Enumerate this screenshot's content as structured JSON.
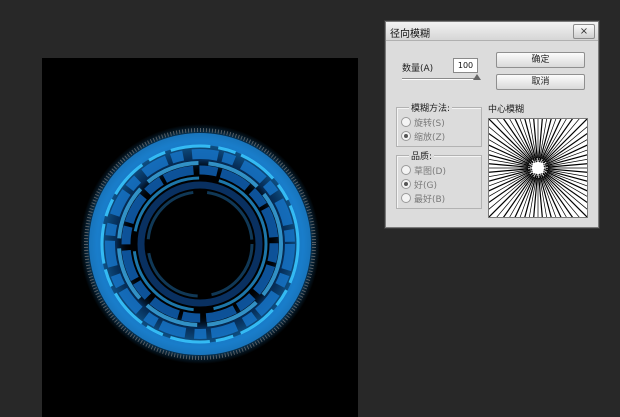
{
  "dialog": {
    "title": "径向模糊",
    "close_label": "×",
    "amount_label": "数量(A)",
    "amount_value": "100",
    "amount_level_percent": 100,
    "ok_label": "确定",
    "cancel_label": "取消",
    "method_group_label": "模糊方法:",
    "method_options": [
      "旋转(S)",
      "缩放(Z)"
    ],
    "method_selected": "缩放(Z)",
    "quality_group_label": "品质:",
    "quality_options": [
      "草图(D)",
      "好(G)",
      "最好(B)"
    ],
    "quality_selected": "好(G)",
    "center_label": "中心模糊"
  },
  "colors": {
    "workspace_bg": "#282828",
    "canvas_bg": "#000000",
    "ring_blue": "#1e8fe0",
    "ring_cyan": "#39c6ff",
    "ring_dark_blue": "#0b3c78"
  }
}
